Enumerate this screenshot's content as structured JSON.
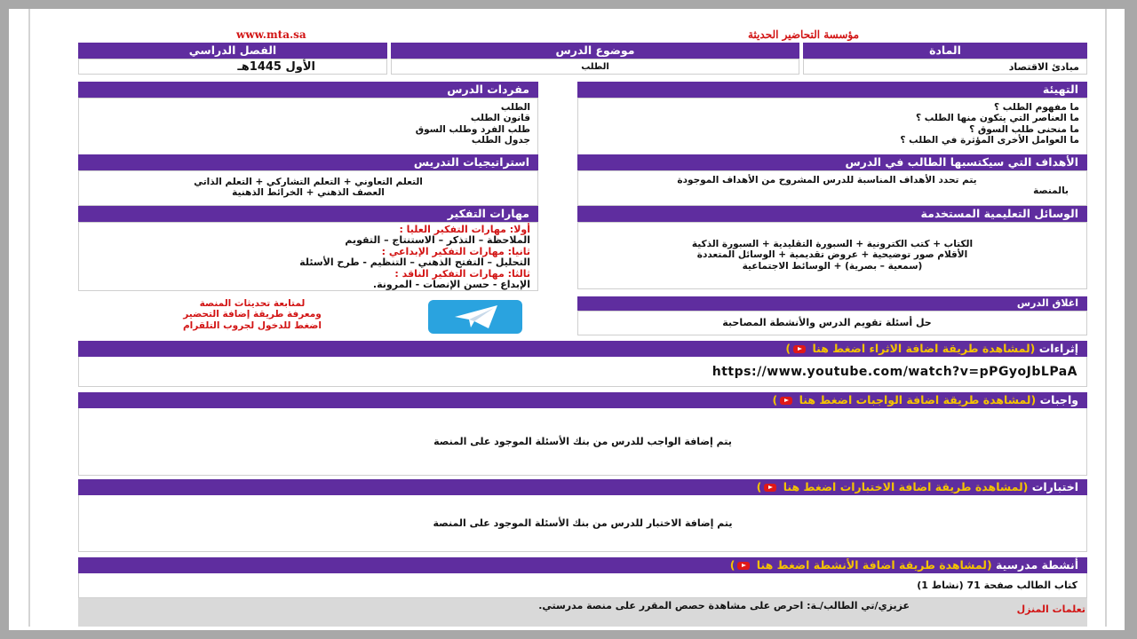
{
  "top": {
    "org": "مؤسسة التحاضير الحديثة",
    "url": "www.mta.sa"
  },
  "info": {
    "subject_label": "المادة",
    "subject_value": "مبادئ الاقتصاد",
    "topic_label": "موضوع الدرس",
    "topic_value": "الطلب",
    "term_label": "الفصل الدراسي",
    "term_value": "الأول 1445هـ"
  },
  "intro": {
    "title": "التهيئة",
    "lines": [
      "ما مفهوم الطلب ؟",
      "ما العناصر التي يتكون منها الطلب ؟",
      "ما منحنى طلب السوق ؟",
      "ما العوامل الأخرى المؤثرة في الطلب ؟"
    ]
  },
  "vocab": {
    "title": "مفردات الدرس",
    "lines": [
      "الطلب",
      "قانون الطلب",
      "طلب الفرد وطلب السوق",
      "جدول الطلب"
    ]
  },
  "goals": {
    "title": "الأهداف التي سيكتسبها الطالب في الدرس",
    "lines": [
      "يتم تحدد الأهداف المناسبة للدرس المشروح من الأهداف الموجودة",
      "بالمنصة"
    ]
  },
  "strategies": {
    "title": "استراتيجيات التدريس",
    "lines": [
      "التعلم التعاوني + التعلم التشاركي + التعلم الذاتي",
      "العصف الذهني + الخرائط الذهنية"
    ]
  },
  "tools": {
    "title": "الوسائل التعليمية المستخدمة",
    "lines": [
      "الكتاب + كتب الكترونية + السبورة التقليدية + السبورة الذكية",
      "الأقلام     صور توضيحية + عروض تقديمية + الوسائل المتعددة",
      "(سمعية – بصرية) + الوسائط الاجتماعية"
    ]
  },
  "thinking": {
    "title": "مهارات التفكير",
    "lines": [
      {
        "text": "أولا: مهارات التفكير العليا :",
        "red": true
      },
      {
        "text": "الملاحظة – التذكر – الاستنتاج – التقويم",
        "red": false
      },
      {
        "text": "ثانيا: مهارات التفكير الإبداعي :",
        "red": true
      },
      {
        "text": "التحليل – التفتح الذهني – التنظيم - طرح الأسئلة",
        "red": false
      },
      {
        "text": "ثالثا: مهارات التفكير الناقد :",
        "red": true
      },
      {
        "text": "الإبداع - حسن الإنصات - المرونة.",
        "red": false
      }
    ]
  },
  "telegram_note": {
    "lines": [
      "لمتابعة تحديثات المنصة",
      "ومعرفة طريقة إضافة التحضير",
      "اضغط للدخول لجروب التلقرام"
    ]
  },
  "closing": {
    "title": "اغلاق الدرس",
    "text": "حل أسئلة تقويم الدرس والأنشطة المصاحبة"
  },
  "enrich": {
    "title": "إثراءات",
    "link": "(لمشاهدة طريقة اضافة الاثراء اضغط هنا",
    "url": "https://www.youtube.com/watch?v=pPGyoJbLPaA"
  },
  "homework": {
    "title": "واجبات",
    "link": "(لمشاهدة طريقة اضافة الواجبات اضغط هنا",
    "text": "يتم إضافة الواجب للدرس من بنك الأسئلة الموجود على المنصة"
  },
  "tests": {
    "title": "اختبارات",
    "link": "(لمشاهدة طريقة اضافة الاختبارات اضغط هنا",
    "text": "يتم إضافة الاختبار للدرس من بنك الأسئلة الموجود على المنصة"
  },
  "activities": {
    "title": "أنشطة مدرسية",
    "link": "(لمشاهدة طريقة اضافة الأنشطة اضغط هنا",
    "text": "كتاب الطالب صفحة 71 (نشاط 1)"
  },
  "footer": {
    "label": "تعلمات المنزل",
    "text": "عزيزي/تي الطالب/ـة: احرص على مشاهدة حصص المقرر على منصة مدرستي."
  },
  "colors": {
    "header": "#5f2d9f",
    "accent_red": "#d21414",
    "telegram": "#2aa3df"
  }
}
